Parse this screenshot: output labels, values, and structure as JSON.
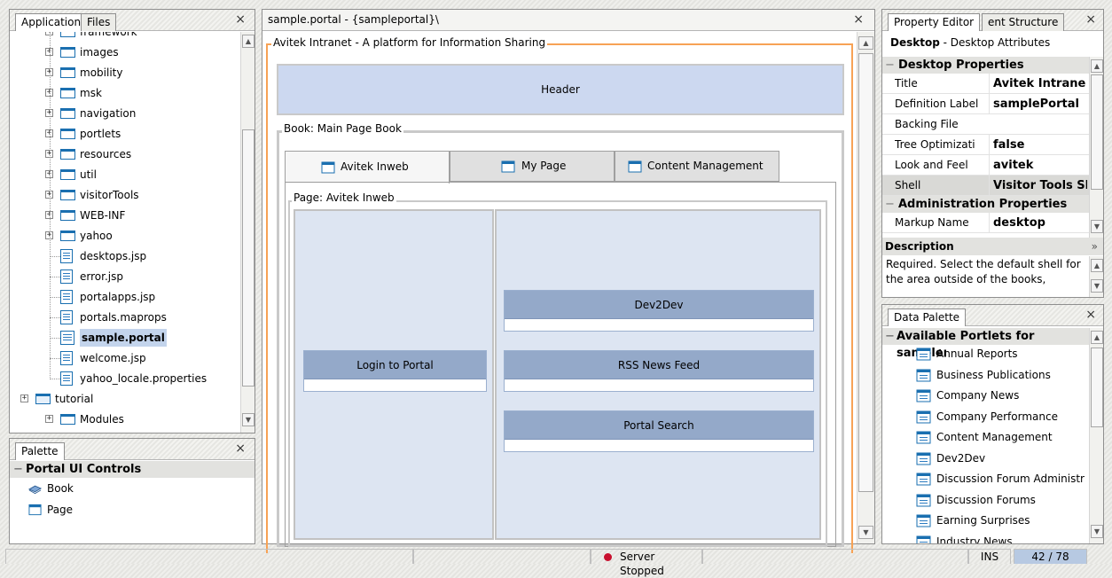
{
  "left_top_panel": {
    "tabs": [
      {
        "label": "Application",
        "active": true
      },
      {
        "label": "Files",
        "active": false
      }
    ],
    "close_glyph": "×",
    "tree": [
      {
        "label": "framework",
        "kind": "folder",
        "expandable": true
      },
      {
        "label": "images",
        "kind": "folder",
        "expandable": true
      },
      {
        "label": "mobility",
        "kind": "folder",
        "expandable": true
      },
      {
        "label": "msk",
        "kind": "folder",
        "expandable": true
      },
      {
        "label": "navigation",
        "kind": "folder",
        "expandable": true
      },
      {
        "label": "portlets",
        "kind": "folder",
        "expandable": true
      },
      {
        "label": "resources",
        "kind": "folder",
        "expandable": true
      },
      {
        "label": "util",
        "kind": "folder",
        "expandable": true
      },
      {
        "label": "visitorTools",
        "kind": "folder",
        "expandable": true
      },
      {
        "label": "WEB-INF",
        "kind": "folder",
        "expandable": true
      },
      {
        "label": "yahoo",
        "kind": "folder",
        "expandable": true
      },
      {
        "label": "desktops.jsp",
        "kind": "file",
        "expandable": false
      },
      {
        "label": "error.jsp",
        "kind": "file",
        "expandable": false
      },
      {
        "label": "portalapps.jsp",
        "kind": "file",
        "expandable": false
      },
      {
        "label": "portals.maprops",
        "kind": "file",
        "expandable": false
      },
      {
        "label": "sample.portal",
        "kind": "portal",
        "expandable": false,
        "selected": true
      },
      {
        "label": "welcome.jsp",
        "kind": "file",
        "expandable": false
      },
      {
        "label": "yahoo_locale.properties",
        "kind": "file",
        "expandable": false
      },
      {
        "label": "tutorial",
        "kind": "project",
        "expandable": true
      },
      {
        "label": "Modules",
        "kind": "folder",
        "expandable": true
      }
    ]
  },
  "palette_panel": {
    "tab": "Palette",
    "close_glyph": "×",
    "section": "Portal UI Controls",
    "items": [
      {
        "label": "Book",
        "icon": "book-icon"
      },
      {
        "label": "Page",
        "icon": "page-icon"
      }
    ]
  },
  "editor": {
    "tab": "sample.portal - {sampleportal}\\",
    "close_glyph": "×",
    "desktop_legend": "Avitek Intranet - A platform for Information Sharing",
    "header_label": "Header",
    "book_legend": "Book: Main Page Book",
    "book_tabs": [
      "Avitek Inweb",
      "My Page",
      "Content Management"
    ],
    "page_legend": "Page: Avitek Inweb",
    "left_portlets": [
      "Login to Portal"
    ],
    "right_portlets": [
      "Dev2Dev",
      "RSS News Feed",
      "Portal Search"
    ]
  },
  "property_editor": {
    "tabs": [
      {
        "label": "Property Editor",
        "active": true
      },
      {
        "label": "ent Structure",
        "active": false
      }
    ],
    "close_glyph": "×",
    "subject_bold": "Desktop",
    "subject_rest": " - Desktop Attributes",
    "rows": [
      {
        "type": "section",
        "label": "Desktop Properties"
      },
      {
        "type": "prop",
        "key": "Title",
        "value": "Avitek Intrane"
      },
      {
        "type": "prop",
        "key": "Definition Label",
        "value": "samplePortal"
      },
      {
        "type": "prop",
        "key": "Backing File",
        "value": ""
      },
      {
        "type": "prop",
        "key": "Tree Optimizati",
        "value": "false"
      },
      {
        "type": "prop",
        "key": "Look and Feel",
        "value": "avitek"
      },
      {
        "type": "prop",
        "key": "Shell",
        "value": "Visitor Tools Sl",
        "highlight": true
      },
      {
        "type": "section",
        "label": "Administration Properties"
      },
      {
        "type": "prop",
        "key": "Markup Name",
        "value": "desktop"
      }
    ],
    "description_title": "Description",
    "description_text": "Required. Select the default shell for the area outside of the books,"
  },
  "data_palette": {
    "tab": "Data Palette",
    "close_glyph": "×",
    "section": "Available Portlets for sampleı",
    "items": [
      "Annual Reports",
      "Business Publications",
      "Company News",
      "Company Performance",
      "Content Management",
      "Dev2Dev",
      "Discussion Forum Administr",
      "Discussion Forums",
      "Earning Surprises",
      "Industry News"
    ]
  },
  "status_bar": {
    "server_status": "Server Stopped",
    "server_color": "#c8102e",
    "mode": "INS",
    "position": "42 / 78"
  },
  "colors": {
    "portlet_header": "#94a9c9",
    "header_region": "#ccd8f0",
    "desktop_border": "#f7a255",
    "selection": "#c3d4ec"
  }
}
